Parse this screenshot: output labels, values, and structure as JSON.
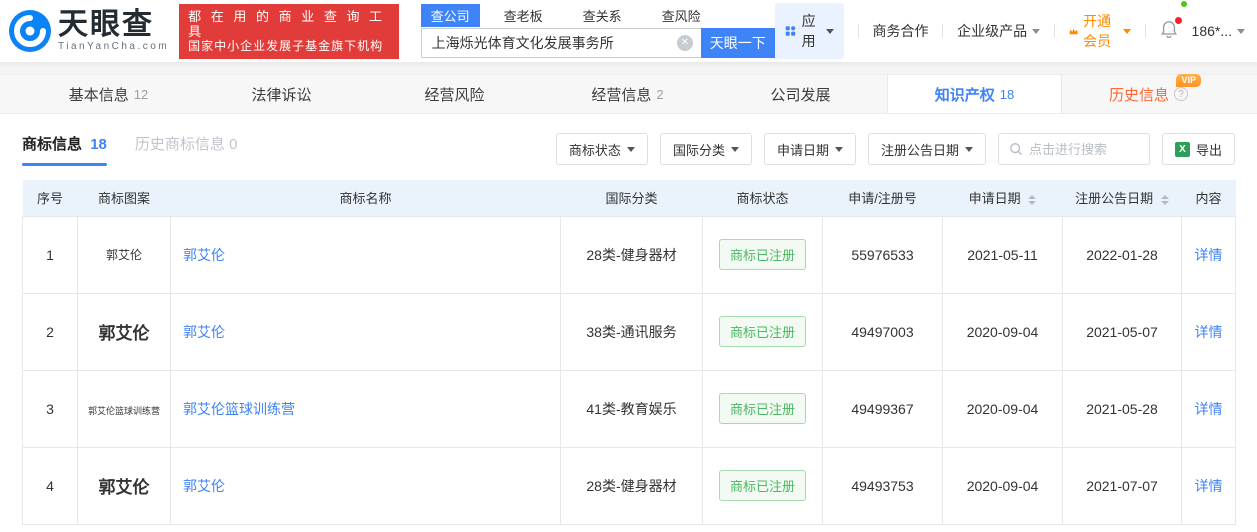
{
  "header": {
    "logo": {
      "brand": "天眼查",
      "domain": "TianYanCha.com"
    },
    "slogan": {
      "line1": "都 在 用 的 商 业 查 询 工 具",
      "line2": "国家中小企业发展子基金旗下机构"
    },
    "search": {
      "tabs": [
        {
          "label": "查公司"
        },
        {
          "label": "查老板"
        },
        {
          "label": "查关系"
        },
        {
          "label": "查风险"
        }
      ],
      "value": "上海烁光体育文化发展事务所",
      "button": "天眼一下"
    },
    "nav": {
      "apps": "应用",
      "biz": "商务合作",
      "enterprise": "企业级产品",
      "vip": "开通会员",
      "phone": "186*..."
    }
  },
  "tabs": [
    {
      "label": "基本信息",
      "count": "12"
    },
    {
      "label": "法律诉讼",
      "count": ""
    },
    {
      "label": "经营风险",
      "count": ""
    },
    {
      "label": "经营信息",
      "count": "2"
    },
    {
      "label": "公司发展",
      "count": ""
    },
    {
      "label": "知识产权",
      "count": "18"
    },
    {
      "label": "历史信息",
      "count": "",
      "vip": "VIP"
    }
  ],
  "subtabs": [
    {
      "label": "商标信息",
      "count": "18"
    },
    {
      "label": "历史商标信息",
      "count": "0"
    }
  ],
  "filters": {
    "status": "商标状态",
    "intl_class": "国际分类",
    "apply_date": "申请日期",
    "reg_pub_date": "注册公告日期",
    "search_placeholder": "点击进行搜索",
    "export": "导出"
  },
  "table": {
    "headers": [
      "序号",
      "商标图案",
      "商标名称",
      "国际分类",
      "商标状态",
      "申请/注册号",
      "申请日期",
      "注册公告日期",
      "内容"
    ],
    "rows": [
      {
        "no": "1",
        "image_text": "郭艾伦",
        "name": "郭艾伦",
        "intl_class": "28类-健身器材",
        "status": "商标已注册",
        "reg_no": "55976533",
        "apply_date": "2021-05-11",
        "pub_date": "2022-01-28",
        "detail": "详情"
      },
      {
        "no": "2",
        "image_text": "郭艾伦",
        "name": "郭艾伦",
        "intl_class": "38类-通讯服务",
        "status": "商标已注册",
        "reg_no": "49497003",
        "apply_date": "2020-09-04",
        "pub_date": "2021-05-07",
        "detail": "详情"
      },
      {
        "no": "3",
        "image_text": "郭艾伦篮球训练营",
        "name": "郭艾伦篮球训练营",
        "intl_class": "41类-教育娱乐",
        "status": "商标已注册",
        "reg_no": "49499367",
        "apply_date": "2020-09-04",
        "pub_date": "2021-05-28",
        "detail": "详情"
      },
      {
        "no": "4",
        "image_text": "郭艾伦",
        "name": "郭艾伦",
        "intl_class": "28类-健身器材",
        "status": "商标已注册",
        "reg_no": "49493753",
        "apply_date": "2020-09-04",
        "pub_date": "2021-07-07",
        "detail": "详情"
      }
    ]
  },
  "icons": {
    "clear": "✕",
    "question": "?",
    "excel": "X"
  },
  "colors": {
    "brand_blue": "#3e83f8",
    "slogan_red": "#e13c39",
    "vip_orange": "#ff8a00",
    "history_orange": "#ff6633",
    "status_green": "#4bb862",
    "table_header_bg": "#eaf3fc"
  }
}
